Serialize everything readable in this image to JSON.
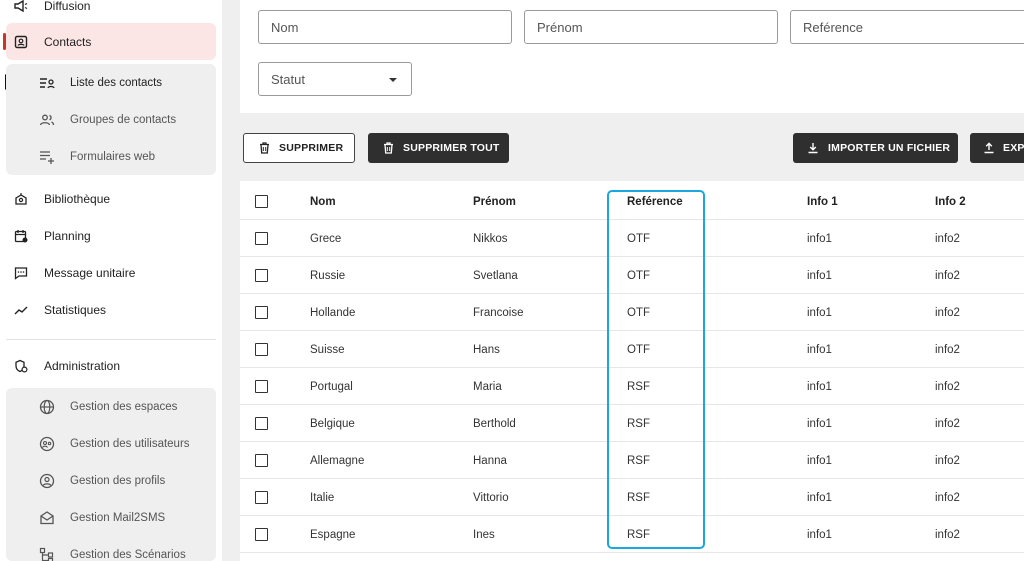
{
  "sidebar": {
    "top_items": [
      {
        "label": "Diffusion",
        "icon": "megaphone-icon"
      },
      {
        "label": "Contacts",
        "icon": "contact-card-icon"
      }
    ],
    "contacts_sub": [
      {
        "label": "Liste des contacts",
        "icon": "contact-list-icon"
      },
      {
        "label": "Groupes de contacts",
        "icon": "group-icon"
      },
      {
        "label": "Formulaires web",
        "icon": "form-list-icon"
      }
    ],
    "mid_items": [
      {
        "label": "Bibliothèque",
        "icon": "library-icon"
      },
      {
        "label": "Planning",
        "icon": "calendar-icon"
      },
      {
        "label": "Message unitaire",
        "icon": "message-icon"
      },
      {
        "label": "Statistiques",
        "icon": "chart-line-icon"
      }
    ],
    "admin": {
      "label": "Administration",
      "icon": "admin-settings-icon"
    },
    "admin_sub": [
      {
        "label": "Gestion des espaces",
        "icon": "globe-icon"
      },
      {
        "label": "Gestion des utilisateurs",
        "icon": "users-manage-icon"
      },
      {
        "label": "Gestion des profils",
        "icon": "profile-icon"
      },
      {
        "label": "Gestion Mail2SMS",
        "icon": "mail-icon"
      },
      {
        "label": "Gestion des Scénarios",
        "icon": "scenario-icon"
      }
    ]
  },
  "filters": {
    "nom_placeholder": "Nom",
    "prenom_placeholder": "Prénom",
    "reference_placeholder": "Reférence",
    "statut_placeholder": "Statut"
  },
  "actions": {
    "delete": "SUPPRIMER",
    "delete_all": "SUPPRIMER TOUT",
    "import": "IMPORTER UN FICHIER",
    "export": "EXPO"
  },
  "table": {
    "columns": [
      "Nom",
      "Prénom",
      "Reférence",
      "Info 1",
      "Info 2"
    ],
    "rows": [
      [
        "Grece",
        "Nikkos",
        "OTF",
        "info1",
        "info2"
      ],
      [
        "Russie",
        "Svetlana",
        "OTF",
        "info1",
        "info2"
      ],
      [
        "Hollande",
        "Francoise",
        "OTF",
        "info1",
        "info2"
      ],
      [
        "Suisse",
        "Hans",
        "OTF",
        "info1",
        "info2"
      ],
      [
        "Portugal",
        "Maria",
        "RSF",
        "info1",
        "info2"
      ],
      [
        "Belgique",
        "Berthold",
        "RSF",
        "info1",
        "info2"
      ],
      [
        "Allemagne",
        "Hanna",
        "RSF",
        "info1",
        "info2"
      ],
      [
        "Italie",
        "Vittorio",
        "RSF",
        "info1",
        "info2"
      ],
      [
        "Espagne",
        "Ines",
        "RSF",
        "info1",
        "info2"
      ]
    ]
  },
  "colors": {
    "active_bg": "#fbe6e5",
    "active_marker": "#c0392b",
    "highlight_border": "#1aa7e0",
    "dark_button": "#2f2f2f"
  }
}
